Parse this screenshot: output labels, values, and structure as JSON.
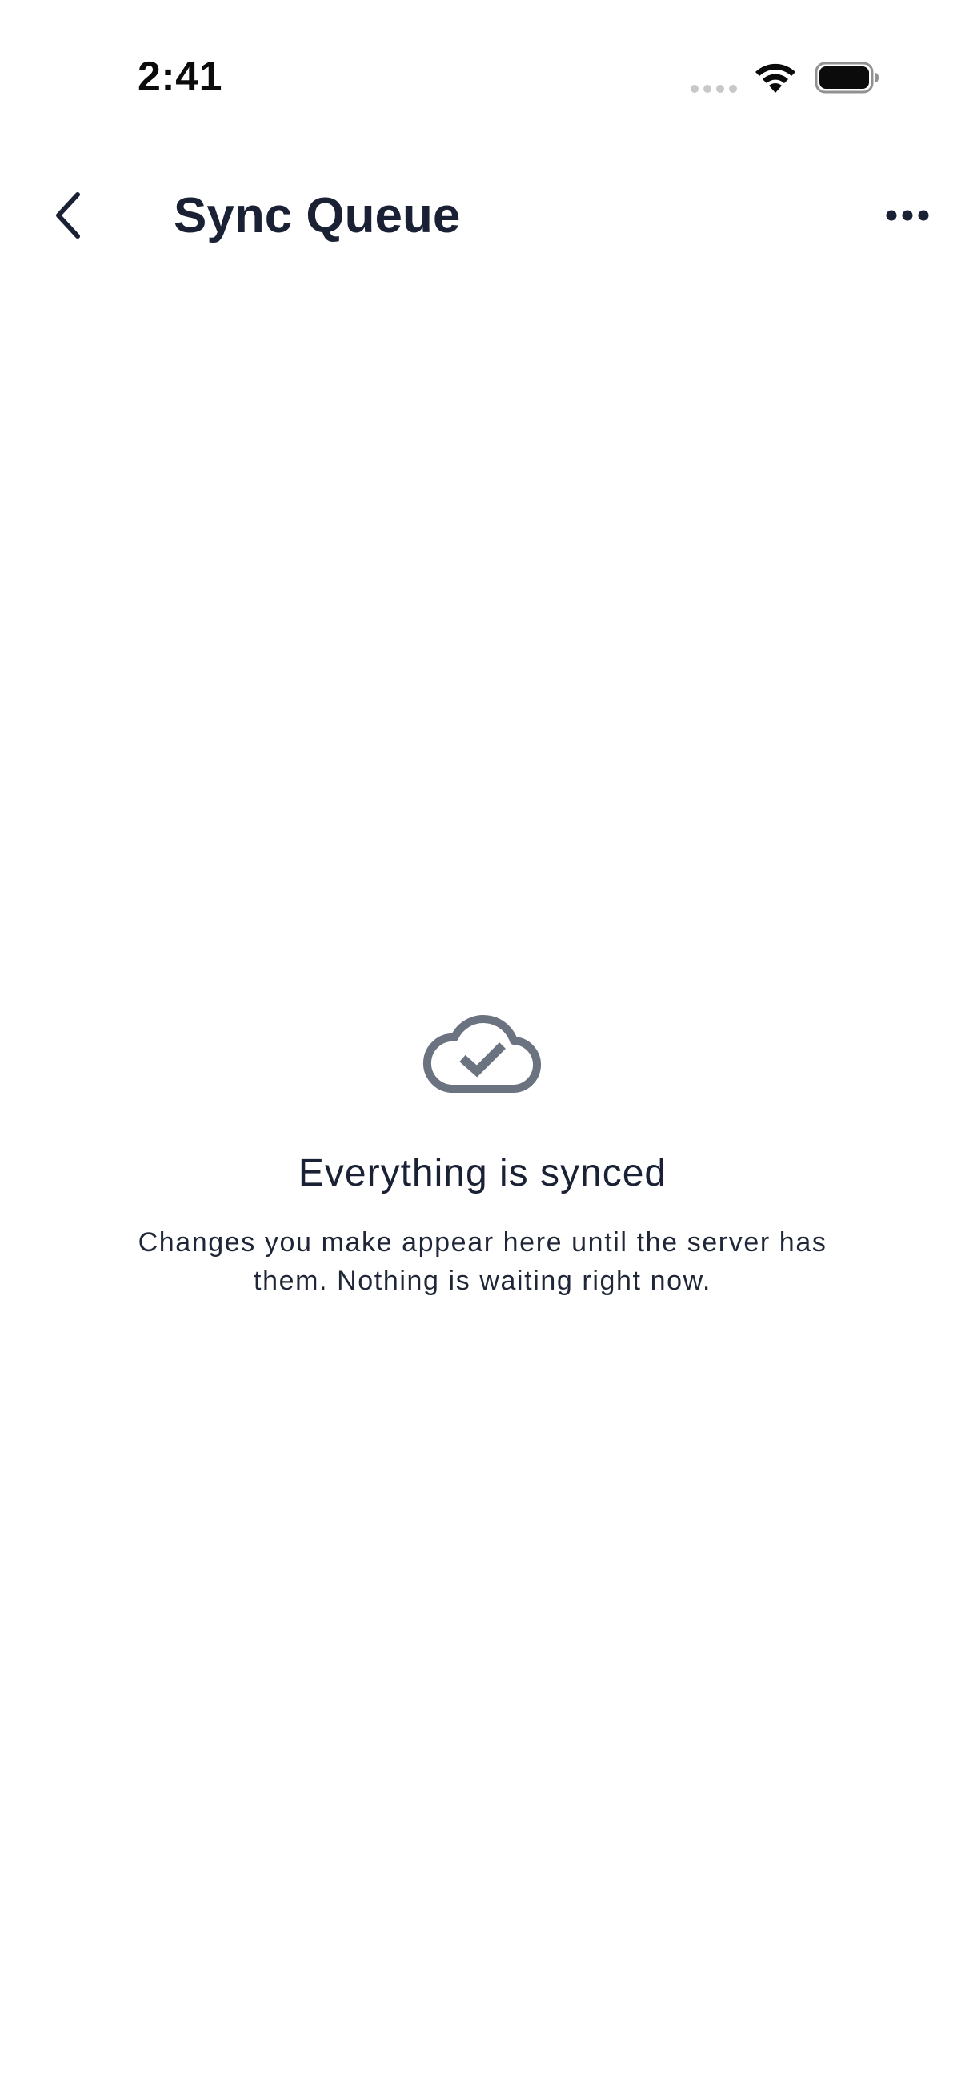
{
  "status_bar": {
    "time": "2:41",
    "icons": [
      "signal-icon",
      "wifi-icon",
      "battery-icon"
    ]
  },
  "header": {
    "back_icon": "chevron-left-icon",
    "title": "Sync Queue",
    "more_icon": "more-horizontal-icon"
  },
  "empty_state": {
    "icon": "cloud-check-icon",
    "title": "Everything is synced",
    "description": "Changes you make appear here until the server has them. Nothing is waiting right now."
  },
  "colors": {
    "text_primary": "#1a2134",
    "icon_muted": "#6b7280",
    "background": "#ffffff"
  }
}
